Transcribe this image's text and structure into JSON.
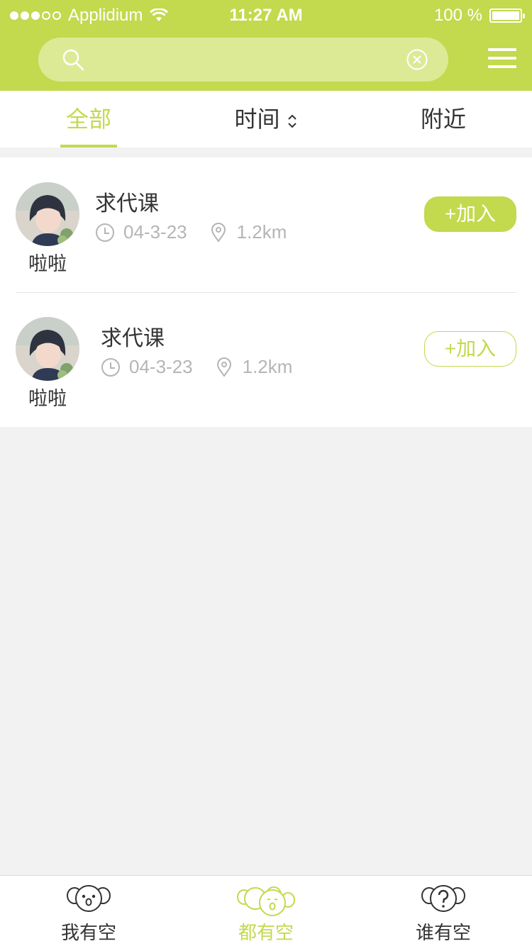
{
  "status_bar": {
    "carrier": "Applidium",
    "time": "11:27 AM",
    "battery": "100 %",
    "signal_dots_filled": 3,
    "signal_dots_total": 5
  },
  "search": {
    "placeholder": "",
    "value": ""
  },
  "tabs": [
    {
      "label": "全部",
      "active": true
    },
    {
      "label": "时间",
      "active": false
    },
    {
      "label": "附近",
      "active": false
    }
  ],
  "list": [
    {
      "user": "啦啦",
      "title": "求代课",
      "date": "04-3-23",
      "distance": "1.2km",
      "button": "+加入",
      "button_style": "filled"
    },
    {
      "user": "啦啦",
      "title": "求代课",
      "date": "04-3-23",
      "distance": "1.2km",
      "button": "+加入",
      "button_style": "outline"
    }
  ],
  "tabbar": [
    {
      "label": "我有空",
      "icon": "koala-face-icon",
      "active": false
    },
    {
      "label": "都有空",
      "icon": "koala-group-icon",
      "active": true
    },
    {
      "label": "谁有空",
      "icon": "koala-question-icon",
      "active": false
    }
  ],
  "colors": {
    "accent": "#c3d94e",
    "search_bg": "#dcea96",
    "background": "#f2f2f2",
    "meta_gray": "#b5b5b5"
  }
}
